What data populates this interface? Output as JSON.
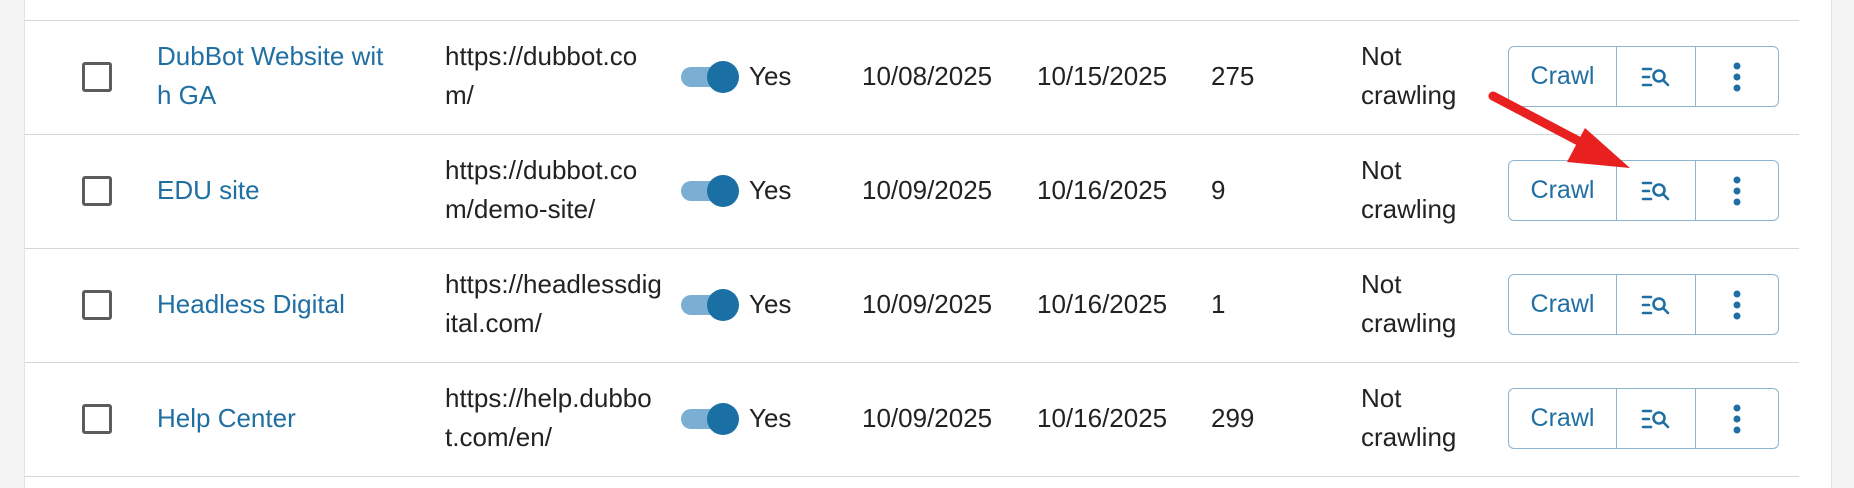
{
  "rows": [
    {
      "name": "DubBot Website with GA",
      "url": "https://dubbot.com/",
      "enabled_label": "Yes",
      "last_crawl": "10/08/2025",
      "next_crawl": "10/15/2025",
      "pages": "275",
      "status": "Not crawling",
      "crawl_label": "Crawl"
    },
    {
      "name": "EDU site",
      "url": "https://dubbot.com/demo-site/",
      "enabled_label": "Yes",
      "last_crawl": "10/09/2025",
      "next_crawl": "10/16/2025",
      "pages": "9",
      "status": "Not crawling",
      "crawl_label": "Crawl"
    },
    {
      "name": "Headless Digital",
      "url": "https://headlessdigital.com/",
      "enabled_label": "Yes",
      "last_crawl": "10/09/2025",
      "next_crawl": "10/16/2025",
      "pages": "1",
      "status": "Not crawling",
      "crawl_label": "Crawl"
    },
    {
      "name": "Help Center",
      "url": "https://help.dubbot.com/en/",
      "enabled_label": "Yes",
      "last_crawl": "10/09/2025",
      "next_crawl": "10/16/2025",
      "pages": "299",
      "status": "Not crawling",
      "crawl_label": "Crawl"
    }
  ],
  "icons": {
    "inspect": "list-search-icon",
    "more": "vertical-ellipsis-icon",
    "annotation": "red-arrow"
  },
  "colors": {
    "link": "#1f6fa3",
    "toggle_on": "#1a6fa5",
    "annotation": "#e8201f"
  }
}
